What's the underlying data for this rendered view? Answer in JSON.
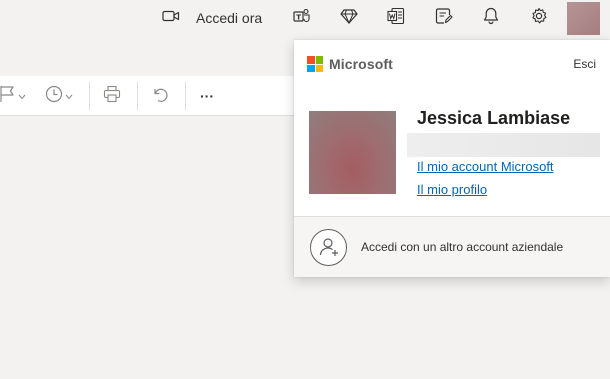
{
  "header": {
    "meet_now_label": "Accedi ora",
    "icons": [
      "video-camera-icon",
      "teams-icon",
      "premium-diamond-icon",
      "office-word-icon",
      "notes-icon",
      "bell-icon",
      "gear-icon"
    ]
  },
  "toolbar": {
    "icons": [
      "flag-icon",
      "clock-icon",
      "print-icon",
      "undo-icon",
      "more-icon"
    ],
    "more_label": "···"
  },
  "account_popup": {
    "brand": "Microsoft",
    "signout_label": "Esci",
    "user_name": "Jessica Lambiase",
    "link_account": "Il mio account Microsoft",
    "link_profile": "Il mio profilo",
    "add_account_label": "Accedi con un altro account aziendale"
  },
  "colors": {
    "ms_red": "#f25022",
    "ms_green": "#7fba00",
    "ms_blue": "#00a4ef",
    "ms_yellow": "#ffb900",
    "link": "#0067b8"
  }
}
